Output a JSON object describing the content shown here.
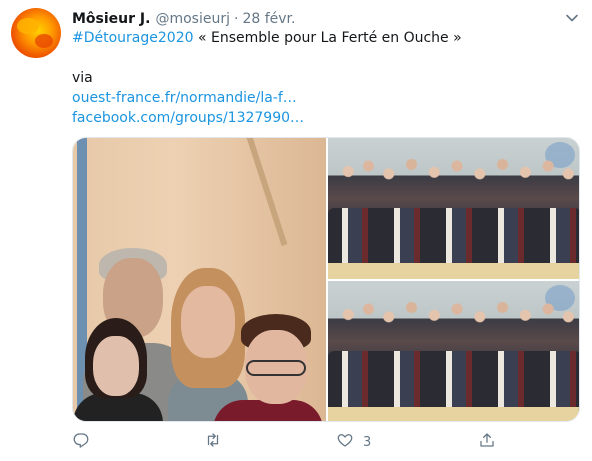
{
  "tweet": {
    "author": {
      "display_name": "Môsieur J.",
      "handle": "@mosieurj"
    },
    "separator": "·",
    "date": "28 févr.",
    "hashtag": "#Détourage2020",
    "title_text": " « Ensemble pour La Ferté en Ouche »",
    "via": "via",
    "links": [
      "ouest-france.fr/normandie/la-f…",
      "facebook.com/groups/1327990…"
    ],
    "media": [
      {
        "icon": "photo-portrait-cutout"
      },
      {
        "icon": "photo-group"
      },
      {
        "icon": "photo-group"
      }
    ],
    "actions": {
      "reply_icon": "reply-icon",
      "retweet_icon": "retweet-icon",
      "like_icon": "heart-icon",
      "like_count": "3",
      "share_icon": "share-icon"
    }
  },
  "colors": {
    "link": "#1b95e0",
    "secondary_text": "#657786",
    "primary_text": "#14171a"
  }
}
